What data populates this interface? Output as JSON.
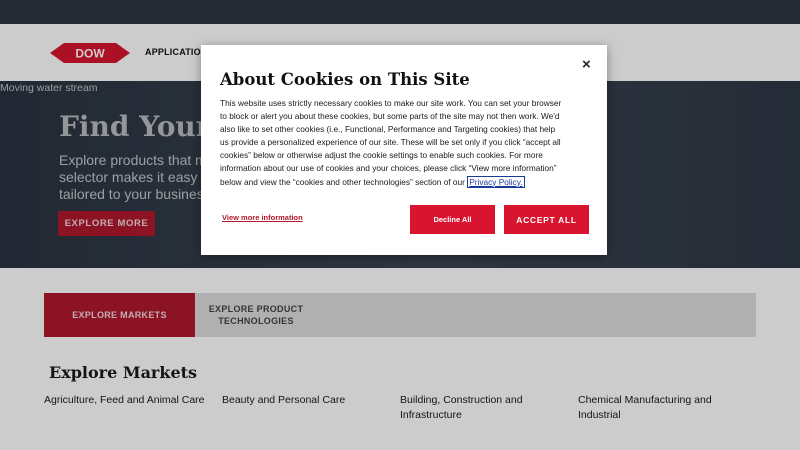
{
  "header": {
    "logo_text": "DOW",
    "nav_item": "APPLICATIONS"
  },
  "hero": {
    "image_alt": "Moving water stream",
    "title": "Find Your",
    "desc_lines": [
      "Explore products that m",
      "selector makes it easy t",
      "tailored to your business"
    ],
    "button": "EXPLORE MORE"
  },
  "tabs": [
    {
      "label": "EXPLORE MARKETS"
    },
    {
      "label_line1": "EXPLORE PRODUCT",
      "label_line2": "TECHNOLOGIES"
    }
  ],
  "markets": {
    "title": "Explore Markets",
    "items": [
      {
        "line1": "Agriculture, Feed and Animal Care",
        "line2": ""
      },
      {
        "line1": "Beauty and Personal Care",
        "line2": ""
      },
      {
        "line1": "Building, Construction and",
        "line2": "Infrastructure"
      },
      {
        "line1": "Chemical Manufacturing and",
        "line2": "Industrial"
      }
    ]
  },
  "cookie_modal": {
    "title": "About Cookies on This Site",
    "close": "×",
    "body_lines": [
      "This website uses strictly necessary cookies to make our site work. You can set your browser",
      "to block or alert you about these cookies, but some parts of the site may not then work. We'd",
      "also like to set other cookies (i.e., Functional, Performance and Targeting cookies) that help",
      "us provide a personalized experience of our site. These will be set only if you click “accept all",
      "cookies” below or otherwise adjust the cookie settings to enable such cookies. For more",
      "information about our use of cookies and your choices, please click “View more information”",
      "below and view the “cookies and other technologies” section of our"
    ],
    "privacy_link": "Privacy Policy.",
    "more_info": "View more information",
    "decline": "Decline All",
    "accept": "ACCEPT ALL"
  },
  "colors": {
    "brand_red": "#d8142e",
    "dark_red": "#b0182d",
    "topbar": "#2c3542"
  }
}
